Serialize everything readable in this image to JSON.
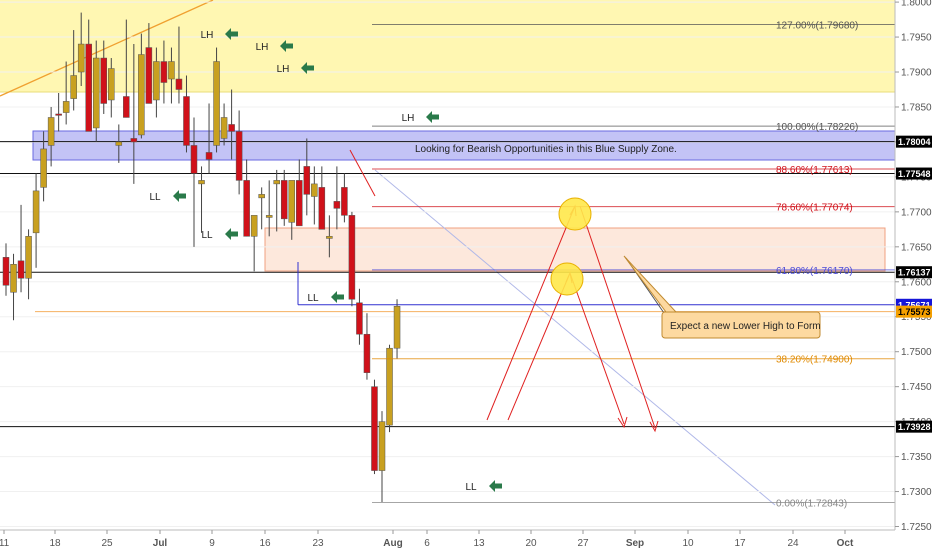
{
  "chart_data": {
    "type": "candlestick",
    "x_ticks": [
      "11",
      "18",
      "25",
      "Jul",
      "9",
      "16",
      "23",
      "Aug",
      "6",
      "13",
      "20",
      "27",
      "Sep",
      "10",
      "17",
      "24",
      "Oct"
    ],
    "y_ticks": [
      "1.80000",
      "1.79500",
      "1.79000",
      "1.78500",
      "1.78000",
      "1.77500",
      "1.77000",
      "1.76500",
      "1.76000",
      "1.75500",
      "1.75000",
      "1.74500",
      "1.74000",
      "1.73500",
      "1.73000",
      "1.72500"
    ],
    "ylim": [
      1.7245,
      1.8003
    ],
    "colors": {
      "bull": "#c8a020",
      "bear": "#d0111a",
      "fib": "#8a8a8a",
      "supply": "#4a4ad8",
      "zone_yellow": "#fff6b0",
      "zone_orange": "#fde4d6",
      "arrow": "#e02020",
      "marker": "#2a7a4a"
    },
    "fib_levels": [
      {
        "label": "127.00%(1.79680)",
        "value": 1.7968,
        "color": "#555555"
      },
      {
        "label": "100.00%(1.78226)",
        "value": 1.78226,
        "color": "#555555"
      },
      {
        "label": "88.60%(1.77613)",
        "value": 1.77613,
        "color": "#d0111a"
      },
      {
        "label": "78.60%(1.77074)",
        "value": 1.77074,
        "color": "#d0111a"
      },
      {
        "label": "61.80%(1.76170)",
        "value": 1.7617,
        "color": "#4a4ad8"
      },
      {
        "label": "38.20%(1.74900)",
        "value": 1.749,
        "color": "#e08a00"
      },
      {
        "label": "0.00%(1.72843)",
        "value": 1.72843,
        "color": "#888888"
      }
    ],
    "price_tags": [
      {
        "text": "1.78004",
        "value": 1.78004,
        "bg": "#000000",
        "fg": "#ffffff"
      },
      {
        "text": "1.77548",
        "value": 1.77548,
        "bg": "#000000",
        "fg": "#ffffff"
      },
      {
        "text": "1.76137",
        "value": 1.76137,
        "bg": "#000000",
        "fg": "#ffffff"
      },
      {
        "text": "1.75671",
        "value": 1.75671,
        "bg": "#1515d8",
        "fg": "#ffffff"
      },
      {
        "text": "1.75573",
        "value": 1.75573,
        "bg": "#f5a000",
        "fg": "#000000"
      },
      {
        "text": "1.73928",
        "value": 1.73928,
        "bg": "#000000",
        "fg": "#ffffff"
      }
    ],
    "candles": [
      {
        "o": 1.7635,
        "h": 1.7655,
        "l": 1.758,
        "c": 1.7595
      },
      {
        "o": 1.7585,
        "h": 1.764,
        "l": 1.7545,
        "c": 1.7625
      },
      {
        "o": 1.763,
        "h": 1.771,
        "l": 1.7585,
        "c": 1.7605
      },
      {
        "o": 1.7605,
        "h": 1.7675,
        "l": 1.7575,
        "c": 1.7665
      },
      {
        "o": 1.767,
        "h": 1.7755,
        "l": 1.762,
        "c": 1.773
      },
      {
        "o": 1.7735,
        "h": 1.7815,
        "l": 1.7715,
        "c": 1.779
      },
      {
        "o": 1.7795,
        "h": 1.785,
        "l": 1.7765,
        "c": 1.7835
      },
      {
        "o": 1.784,
        "h": 1.787,
        "l": 1.7815,
        "c": 1.7838
      },
      {
        "o": 1.7842,
        "h": 1.7915,
        "l": 1.7825,
        "c": 1.7858
      },
      {
        "o": 1.7862,
        "h": 1.796,
        "l": 1.7845,
        "c": 1.7895
      },
      {
        "o": 1.79,
        "h": 1.7985,
        "l": 1.788,
        "c": 1.794
      },
      {
        "o": 1.794,
        "h": 1.7975,
        "l": 1.782,
        "c": 1.7815
      },
      {
        "o": 1.782,
        "h": 1.7945,
        "l": 1.78,
        "c": 1.792
      },
      {
        "o": 1.792,
        "h": 1.7945,
        "l": 1.784,
        "c": 1.7855
      },
      {
        "o": 1.786,
        "h": 1.792,
        "l": 1.7835,
        "c": 1.7905
      },
      {
        "o": 1.7795,
        "h": 1.7825,
        "l": 1.777,
        "c": 1.78
      },
      {
        "o": 1.7865,
        "h": 1.7975,
        "l": 1.7835,
        "c": 1.7835
      },
      {
        "o": 1.7805,
        "h": 1.794,
        "l": 1.774,
        "c": 1.78
      },
      {
        "o": 1.781,
        "h": 1.7955,
        "l": 1.7805,
        "c": 1.7925
      },
      {
        "o": 1.7935,
        "h": 1.797,
        "l": 1.7855,
        "c": 1.7855
      },
      {
        "o": 1.786,
        "h": 1.7935,
        "l": 1.7835,
        "c": 1.7915
      },
      {
        "o": 1.7915,
        "h": 1.7945,
        "l": 1.7855,
        "c": 1.7885
      },
      {
        "o": 1.789,
        "h": 1.7935,
        "l": 1.7855,
        "c": 1.7915
      },
      {
        "o": 1.789,
        "h": 1.7965,
        "l": 1.7855,
        "c": 1.7875
      },
      {
        "o": 1.7865,
        "h": 1.7895,
        "l": 1.7785,
        "c": 1.7795
      },
      {
        "o": 1.7795,
        "h": 1.7835,
        "l": 1.765,
        "c": 1.7755
      },
      {
        "o": 1.774,
        "h": 1.7765,
        "l": 1.767,
        "c": 1.7745
      },
      {
        "o": 1.7785,
        "h": 1.7855,
        "l": 1.7755,
        "c": 1.7775
      },
      {
        "o": 1.7795,
        "h": 1.7935,
        "l": 1.7785,
        "c": 1.7915
      },
      {
        "o": 1.7805,
        "h": 1.7855,
        "l": 1.7795,
        "c": 1.7835
      },
      {
        "o": 1.7825,
        "h": 1.7875,
        "l": 1.7775,
        "c": 1.7815
      },
      {
        "o": 1.7815,
        "h": 1.7845,
        "l": 1.7725,
        "c": 1.7745
      },
      {
        "o": 1.7745,
        "h": 1.7775,
        "l": 1.7665,
        "c": 1.7665
      },
      {
        "o": 1.7665,
        "h": 1.7685,
        "l": 1.7615,
        "c": 1.7695
      },
      {
        "o": 1.772,
        "h": 1.7735,
        "l": 1.7675,
        "c": 1.7725
      },
      {
        "o": 1.7692,
        "h": 1.7745,
        "l": 1.7665,
        "c": 1.7695
      },
      {
        "o": 1.774,
        "h": 1.776,
        "l": 1.7672,
        "c": 1.7745
      },
      {
        "o": 1.7745,
        "h": 1.776,
        "l": 1.768,
        "c": 1.769
      },
      {
        "o": 1.7685,
        "h": 1.7735,
        "l": 1.766,
        "c": 1.7745
      },
      {
        "o": 1.7745,
        "h": 1.7775,
        "l": 1.7695,
        "c": 1.768
      },
      {
        "o": 1.7765,
        "h": 1.7805,
        "l": 1.7695,
        "c": 1.7725
      },
      {
        "o": 1.7722,
        "h": 1.7765,
        "l": 1.7682,
        "c": 1.774
      },
      {
        "o": 1.7735,
        "h": 1.7765,
        "l": 1.7695,
        "c": 1.7675
      },
      {
        "o": 1.7662,
        "h": 1.7695,
        "l": 1.7635,
        "c": 1.7665
      },
      {
        "o": 1.7715,
        "h": 1.7765,
        "l": 1.7675,
        "c": 1.7705
      },
      {
        "o": 1.7735,
        "h": 1.7755,
        "l": 1.7685,
        "c": 1.7695
      },
      {
        "o": 1.7695,
        "h": 1.77,
        "l": 1.7565,
        "c": 1.7575
      },
      {
        "o": 1.757,
        "h": 1.759,
        "l": 1.751,
        "c": 1.7525
      },
      {
        "o": 1.7525,
        "h": 1.7555,
        "l": 1.746,
        "c": 1.747
      },
      {
        "o": 1.745,
        "h": 1.746,
        "l": 1.7325,
        "c": 1.733
      },
      {
        "o": 1.733,
        "h": 1.7415,
        "l": 1.7285,
        "c": 1.74
      },
      {
        "o": 1.7395,
        "h": 1.751,
        "l": 1.7385,
        "c": 1.7505
      },
      {
        "o": 1.7505,
        "h": 1.7575,
        "l": 1.749,
        "c": 1.7565
      }
    ],
    "annotations": {
      "supply_zone_note": "Looking for Bearish Opportunities in this Blue Supply Zone.",
      "callout": "Expect a new Lower High to Form",
      "labels": [
        {
          "text": "LH",
          "x": 207,
          "y": 38
        },
        {
          "text": "LH",
          "x": 262,
          "y": 50
        },
        {
          "text": "LH",
          "x": 283,
          "y": 72
        },
        {
          "text": "LH",
          "x": 408,
          "y": 121
        },
        {
          "text": "LL",
          "x": 155,
          "y": 200
        },
        {
          "text": "LL",
          "x": 207,
          "y": 238
        },
        {
          "text": "LL",
          "x": 313,
          "y": 301
        },
        {
          "text": "LL",
          "x": 471,
          "y": 490
        }
      ]
    }
  }
}
